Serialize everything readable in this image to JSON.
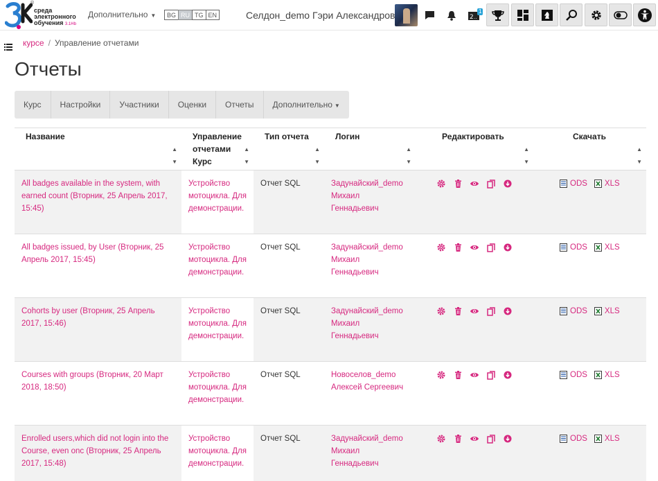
{
  "navbar": {
    "logo_text_line1": "среда",
    "logo_text_line2": "электронного",
    "logo_text_line3": "обучения",
    "logo_text_sup": "3.1Hb",
    "more_label": "Дополнительно",
    "languages": [
      {
        "code": "BG",
        "active": false
      },
      {
        "code": "RU",
        "active": true
      },
      {
        "code": "TG",
        "active": false
      },
      {
        "code": "EN",
        "active": false
      }
    ],
    "username": "Селдон_demo Гэри Александрович",
    "notification_badge": "1",
    "icons": [
      "chat-icon",
      "bell-icon",
      "quiz-count-icon",
      "trophy-icon",
      "dashboard-icon",
      "chess-icon",
      "search-icon",
      "gear-icon",
      "toggle-icon",
      "accessibility-icon"
    ]
  },
  "breadcrumb": {
    "course": "курсе",
    "current": "Управление отчетами"
  },
  "page_title": "Отчеты",
  "tabs": [
    "Курс",
    "Настройки",
    "Участники",
    "Оценки",
    "Отчеты",
    "Дополнительно"
  ],
  "table": {
    "headers": {
      "name": "Название",
      "category_line1": "Управление",
      "category_line2": "отчетами",
      "category_line3": "Курс",
      "type": "Тип отчета",
      "login": "Логин",
      "edit": "Редактировать",
      "download": "Скачать"
    },
    "rows": [
      {
        "name": "All badges available in the system, with earned count (Вторник, 25 Апрель 2017, 15:45)",
        "category": "Устройство мотоцикла. Для демонстрации.",
        "type": "Отчет SQL",
        "login": "Задунайский_demo Михаил Геннадьевич",
        "ods": "ODS",
        "xls": "XLS"
      },
      {
        "name": "All badges issued, by User (Вторник, 25 Апрель 2017, 15:45)",
        "category": "Устройство мотоцикла. Для демонстрации.",
        "type": "Отчет SQL",
        "login": "Задунайский_demo Михаил Геннадьевич",
        "ods": "ODS",
        "xls": "XLS"
      },
      {
        "name": "Cohorts by user (Вторник, 25 Апрель 2017, 15:46)",
        "category": "Устройство мотоцикла. Для демонстрации.",
        "type": "Отчет SQL",
        "login": "Задунайский_demo Михаил Геннадьевич",
        "ods": "ODS",
        "xls": "XLS"
      },
      {
        "name": "Courses with groups (Вторник, 20 Март 2018, 18:50)",
        "category": "Устройство мотоцикла. Для демонстрации.",
        "type": "Отчет SQL",
        "login": "Новоселов_demo Алексей Сергеевич",
        "ods": "ODS",
        "xls": "XLS"
      },
      {
        "name": "Enrolled users,which did not login into the Course, even onc (Вторник, 25 Апрель 2017, 15:48)",
        "category": "Устройство мотоцикла. Для демонстрации.",
        "type": "Отчет SQL",
        "login": "Задунайский_demo Михаил Геннадьевич",
        "ods": "ODS",
        "xls": "XLS"
      }
    ]
  },
  "colors": {
    "accent": "#d6287f",
    "tab_bg": "#e6e6e6",
    "row_stripe": "#f2f2f2"
  }
}
